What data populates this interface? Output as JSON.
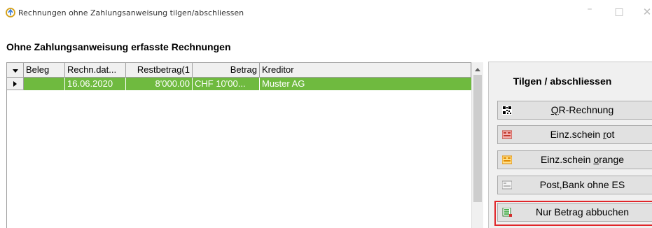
{
  "window": {
    "title": "Rechnungen ohne Zahlungsanweisung tilgen/abschliessen",
    "app_icon": "app-icon",
    "controls": [
      "minimize-icon",
      "maximize-icon",
      "close-icon"
    ]
  },
  "section": {
    "heading": "Ohne Zahlungsanweisung erfasste Rechnungen"
  },
  "grid": {
    "columns": [
      "Beleg",
      "Rechn.dat...",
      "Restbetrag(1",
      "Betrag",
      "Kreditor"
    ],
    "rows": [
      {
        "beleg": "",
        "rechn_dat": "16.06.2020",
        "restbetrag": "8'000.00",
        "betrag": "CHF 10'00...",
        "kreditor": "Muster AG"
      }
    ],
    "row_color": "#6fba3f"
  },
  "panel": {
    "title": "Tilgen / abschliessen",
    "buttons": [
      {
        "pre": "",
        "key": "Q",
        "post": "R-Rechnung",
        "icon": "qr-code-icon"
      },
      {
        "pre": "Einz.schein ",
        "key": "r",
        "post": "ot",
        "icon": "red-slip-icon"
      },
      {
        "pre": "Einz.schein ",
        "key": "o",
        "post": "range",
        "icon": "orange-slip-icon"
      },
      {
        "pre": "Post,Bank ohne ES",
        "key": "",
        "post": "",
        "icon": "grey-slip-icon"
      },
      {
        "pre": "Nur Betrag abbuchen",
        "key": "",
        "post": "",
        "icon": "green-sheet-icon"
      }
    ],
    "highlight_color": "#e0262a"
  }
}
